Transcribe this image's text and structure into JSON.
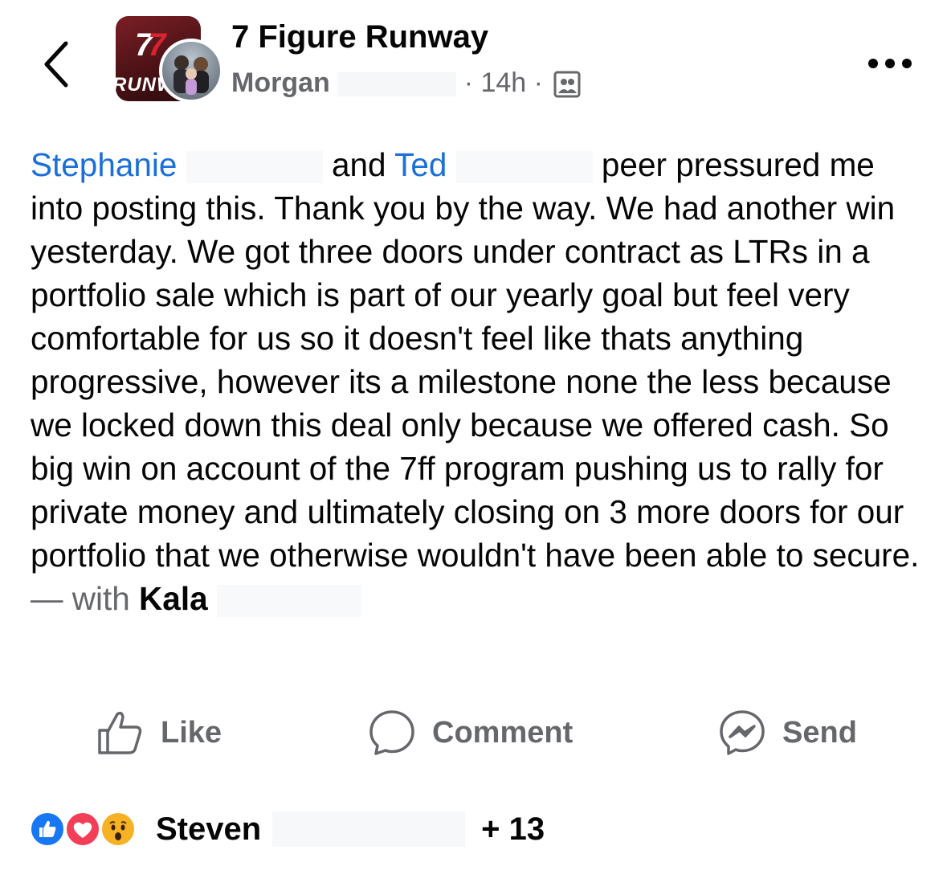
{
  "header": {
    "group_name": "7 Figure Runway",
    "author": "Morgan",
    "timestamp": "14h",
    "separator": "·",
    "group_logo_text": "RUNW",
    "group_logo_number": "7",
    "icons": [
      "back-chevron-icon",
      "group-audience-icon",
      "more-dots-icon"
    ]
  },
  "post": {
    "mention_1": "Stephanie",
    "conj": "and",
    "mention_2": "Ted",
    "body": "peer pressured me into posting this. Thank you by the way. We had another win yesterday. We got three doors under contract as LTRs in a portfolio sale which is part of our yearly goal but feel very comfortable for us so it doesn't feel like thats anything progressive, however its a milestone none the less because we locked down this deal only because we offered cash. So big win on account of the 7ff program pushing us to rally for private money and ultimately closing on 3 more doors for our portfolio that we otherwise wouldn't have been able to secure.",
    "with_prefix": "— with",
    "tagged_person": "Kala"
  },
  "actions": {
    "like_label": "Like",
    "comment_label": "Comment",
    "send_label": "Send",
    "icons": [
      "thumbs-up-icon",
      "comment-bubble-icon",
      "messenger-icon"
    ]
  },
  "reactions": {
    "types": [
      "like",
      "love",
      "wow"
    ],
    "reactor_name": "Steven",
    "more_count": "+ 13"
  },
  "colors": {
    "text": "#050505",
    "secondary": "#65676b",
    "mention": "#1b6fd8",
    "like_blue": "#1877f2",
    "love_red": "#f33e58",
    "wow_yellow": "#f7b125"
  }
}
